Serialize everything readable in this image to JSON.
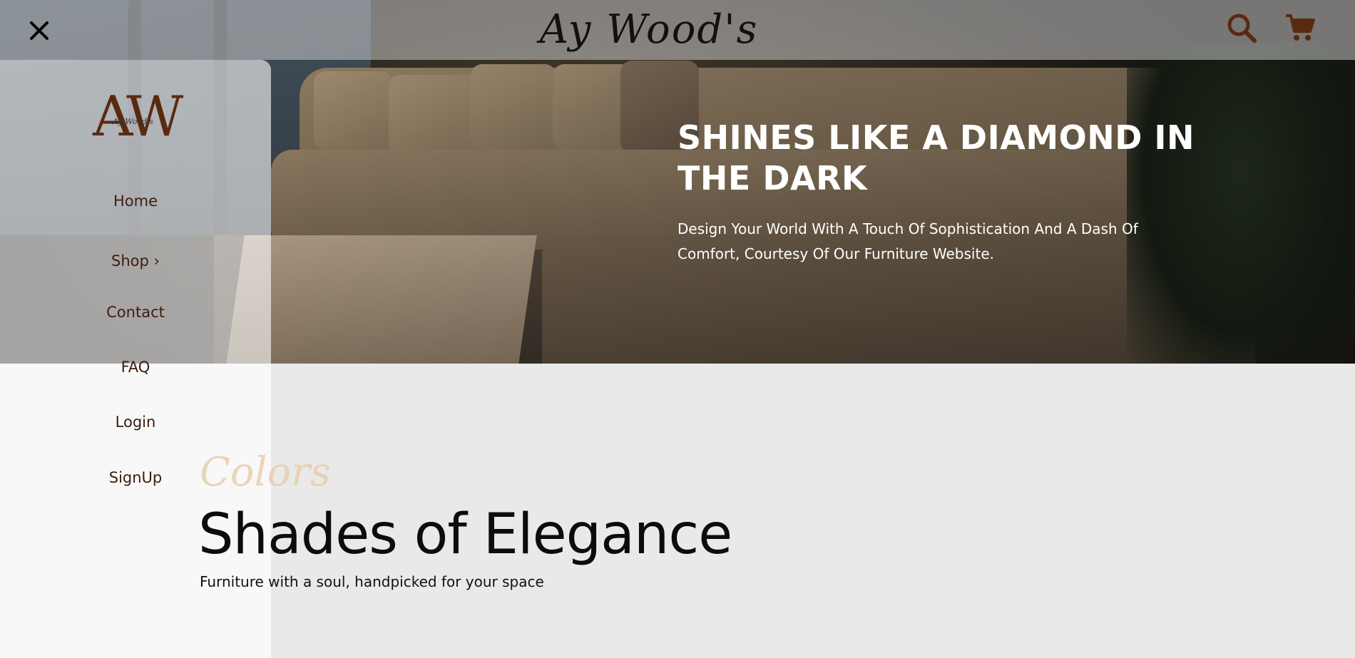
{
  "header": {
    "brand": "Ay Wood's",
    "close_icon": "close-icon",
    "search_icon": "search-icon",
    "cart_icon": "cart-icon"
  },
  "drawer": {
    "logo_monogram": "AW",
    "logo_small_text": "Ay Wood's",
    "items": [
      {
        "label": "Home"
      },
      {
        "label": "Shop ›"
      },
      {
        "label": "Contact"
      },
      {
        "label": "FAQ"
      },
      {
        "label": "Login"
      },
      {
        "label": "SignUp"
      }
    ]
  },
  "hero": {
    "title": "SHINES LIKE A DIAMOND IN THE DARK",
    "subtitle": "Design Your World With A Touch Of Sophistication And A Dash Of Comfort, Courtesy Of Our Furniture Website."
  },
  "section": {
    "script_label": "Colors",
    "title": "Shades of Elegance",
    "subtitle": "Furniture with a soul, handpicked for your space"
  },
  "colors": {
    "accent": "#5a2a10",
    "nav_text": "#3b1e10",
    "script_label": "#e7cfae"
  }
}
